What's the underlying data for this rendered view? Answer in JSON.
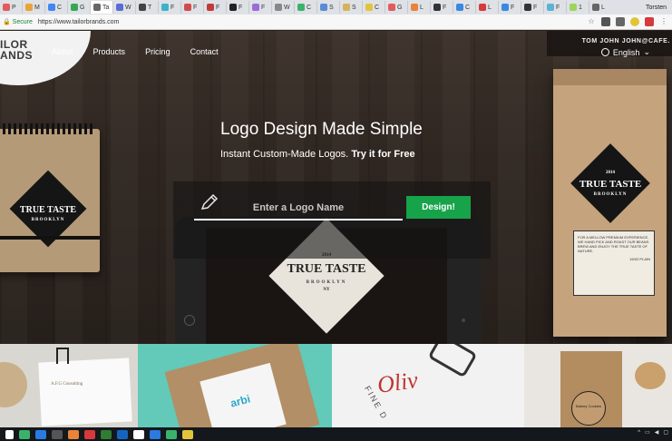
{
  "browser": {
    "tabs": [
      {
        "label": "P",
        "color": "#e35b5b"
      },
      {
        "label": "M",
        "color": "#e8a33a"
      },
      {
        "label": "C",
        "color": "#4285f4"
      },
      {
        "label": "G",
        "color": "#34a853"
      },
      {
        "label": "Ta",
        "color": "#666666"
      },
      {
        "label": "W",
        "color": "#5b6bd6"
      },
      {
        "label": "T",
        "color": "#444444"
      },
      {
        "label": "F",
        "color": "#3ab2c9"
      },
      {
        "label": "F",
        "color": "#d14b4b"
      },
      {
        "label": "F",
        "color": "#c23b3b"
      },
      {
        "label": "F",
        "color": "#222222"
      },
      {
        "label": "F",
        "color": "#9b6bd6"
      },
      {
        "label": "W",
        "color": "#888888"
      },
      {
        "label": "C",
        "color": "#3ab26b"
      },
      {
        "label": "S",
        "color": "#5b8bd6"
      },
      {
        "label": "S",
        "color": "#d6b35b"
      },
      {
        "label": "C",
        "color": "#e2c43a"
      },
      {
        "label": "G",
        "color": "#e35b5b"
      },
      {
        "label": "L",
        "color": "#e8833a"
      },
      {
        "label": "F",
        "color": "#333333"
      },
      {
        "label": "C",
        "color": "#3a88e2"
      },
      {
        "label": "L",
        "color": "#d63a3a"
      },
      {
        "label": "F",
        "color": "#3a88e2"
      },
      {
        "label": "F",
        "color": "#333333"
      },
      {
        "label": "F",
        "color": "#5bb2d6"
      },
      {
        "label": "1",
        "color": "#9bd65b"
      },
      {
        "label": "L",
        "color": "#666666"
      },
      {
        "label": "C",
        "color": "#3ab26b"
      },
      {
        "label": "F",
        "color": "#5b8bd6"
      },
      {
        "label": "L",
        "color": "#4285f4"
      }
    ],
    "user_chip": "Torsten",
    "secure_label": "Secure",
    "url": "https://www.tailorbrands.com"
  },
  "site": {
    "logo_line1": "ILOR",
    "logo_line2": "ANDS",
    "nav": [
      "About",
      "Products",
      "Pricing",
      "Contact"
    ],
    "account": "TOM JOHN JOHN@CAFE.",
    "language": "English",
    "headline": "Logo Design Made Simple",
    "subline_plain": "Instant Custom-Made Logos.",
    "subline_bold": "Try it for Free",
    "input_placeholder": "Enter a Logo Name",
    "design_button": "Design!",
    "notebook_badge": {
      "top": "TTE",
      "main": "TRUE TASTE",
      "sub": "BROOKLYN"
    },
    "tablet_badge": {
      "top": "2014",
      "main": "TRUE TASTE",
      "sub": "BROOKLYN",
      "sub2": "NY"
    },
    "bag_badge": {
      "top": "2014",
      "main": "TRUE TASTE",
      "sub": "BROOKLYN"
    },
    "bag_label_text": "FOR A MELLOW PREMIUM EXPERIENCE, WE HAND PICK AND ROAST OUR BEANS. BREW AND ENJOY THE TRUE TASTE OF NATURE.",
    "bag_weight": "16/02 PLAIN"
  },
  "gallery": {
    "g1_text": "A.F.G Consulting",
    "g2_text": "arbi",
    "g3_text": "Oliv",
    "g3_sub": "FINE D",
    "g4_text": "Bakery Cookies"
  },
  "colors": {
    "accent_green": "#17a34a"
  }
}
